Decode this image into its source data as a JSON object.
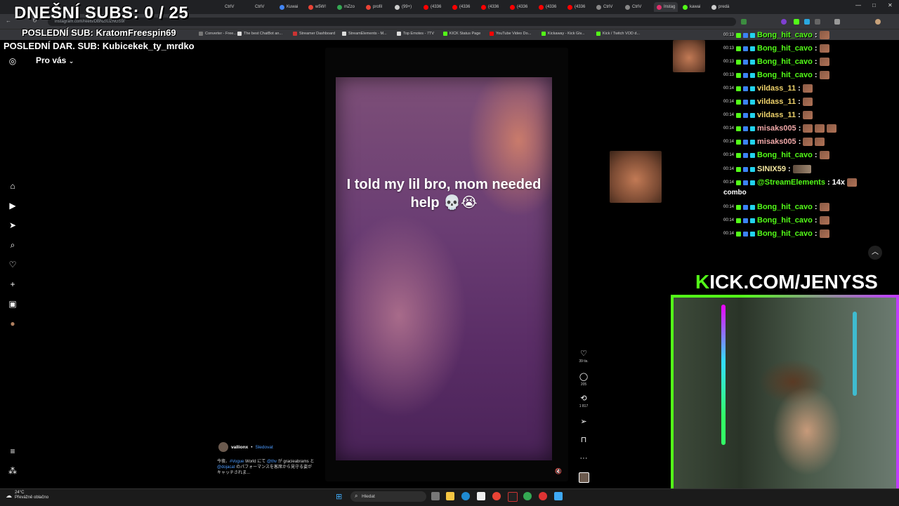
{
  "browser": {
    "tabs": [
      {
        "label": "Kuwai",
        "color": "#4285f4"
      },
      {
        "label": "w5W!",
        "color": "#ea4335"
      },
      {
        "label": "mZzo",
        "color": "#34a853"
      },
      {
        "label": "profil",
        "color": "#ea4335"
      },
      {
        "label": "(99+)",
        "color": "#cccccc"
      },
      {
        "label": "(4336",
        "color": "#ff0000"
      },
      {
        "label": "(4336",
        "color": "#ff0000"
      },
      {
        "label": "(4336",
        "color": "#ff0000"
      },
      {
        "label": "(4336",
        "color": "#ff0000"
      },
      {
        "label": "(4336",
        "color": "#ff0000"
      },
      {
        "label": "(4336",
        "color": "#ff0000"
      },
      {
        "label": "CtrlV",
        "color": "#888888"
      },
      {
        "label": "CtrlV",
        "color": "#888888"
      },
      {
        "label": "Instag",
        "color": "#e1306c"
      },
      {
        "label": "kawai",
        "color": "#53fc18"
      },
      {
        "label": "predá",
        "color": "#cccccc"
      }
    ],
    "left_tabs": [
      "CtrlV",
      "CtrlV"
    ],
    "url": "instagram.com/reels/DBNZIUZNGS9/",
    "bookmarks": [
      {
        "label": "Converter - Free...",
        "color": "#777777"
      },
      {
        "label": "The best ChatBot an...",
        "color": "#dddddd"
      },
      {
        "label": "Streamer Dashboard",
        "color": "#cc3333"
      },
      {
        "label": "StreamElements - M...",
        "color": "#dddddd"
      },
      {
        "label": "Top Emotes - 7TV",
        "color": "#dddddd"
      },
      {
        "label": "KICK Status Page",
        "color": "#53fc18"
      },
      {
        "label": "YouTube Video Do...",
        "color": "#ff0000"
      },
      {
        "label": "Kickaway - Kick Giv...",
        "color": "#53fc18"
      },
      {
        "label": "Kick / Twitch VOD d...",
        "color": "#53fc18"
      }
    ]
  },
  "overlay": {
    "subs_goal": "DNEŠNÍ SUBS: 0 / 25",
    "last_sub": "POSLEDNÍ SUB: KratomFreespin69",
    "last_gift": "POSLEDNÍ DAR. SUB: Kubicekek_ty_mrdko",
    "brand_k": "K",
    "brand_rest": "ICK.COM/JENYSS"
  },
  "instagram": {
    "feed_label": "Pro vás",
    "feed_chevron": "⌄",
    "caption": "I told my lil bro, mom needed help 💀😭",
    "actions": {
      "likes": "39 tis.",
      "comments": "205",
      "reposts": "1 817"
    },
    "author": "vallionx",
    "follow": "Sledovat",
    "description_parts": [
      "今夜、",
      "#Vogue",
      " World にて ",
      "@thv",
      " が gracieabrams と ",
      "@dojacat",
      " のパフォーマンスを客席から見守る姿が キャッチされま..."
    ]
  },
  "chat": {
    "messages": [
      {
        "time": "00:13",
        "user": "Bong_hit_cavo",
        "color": "#53fc18",
        "emotes": 1
      },
      {
        "time": "00:13",
        "user": "Bong_hit_cavo",
        "color": "#53fc18",
        "emotes": 1
      },
      {
        "time": "00:13",
        "user": "Bong_hit_cavo",
        "color": "#53fc18",
        "emotes": 1
      },
      {
        "time": "00:13",
        "user": "Bong_hit_cavo",
        "color": "#53fc18",
        "emotes": 1
      },
      {
        "time": "00:14",
        "user": "vildass_11",
        "color": "#f0d36b",
        "emotes": 1
      },
      {
        "time": "00:14",
        "user": "vildass_11",
        "color": "#f0d36b",
        "emotes": 1
      },
      {
        "time": "00:14",
        "user": "vildass_11",
        "color": "#f0d36b",
        "emotes": 1
      },
      {
        "time": "00:14",
        "user": "misaks005",
        "color": "#f0a8a8",
        "emotes": 3
      },
      {
        "time": "00:14",
        "user": "misaks005",
        "color": "#f0a8a8",
        "emotes": 2
      },
      {
        "time": "00:14",
        "user": "Bong_hit_cavo",
        "color": "#53fc18",
        "emotes": 1
      },
      {
        "time": "00:14",
        "user": "SINIX59",
        "color": "#f5e7a0",
        "emotes": 1
      },
      {
        "time": "00:14",
        "user": "@StreamElements",
        "color": "#53fc18",
        "text": "14x",
        "emotes": 1
      },
      {
        "time": "00:14",
        "user": "Bong_hit_cavo",
        "color": "#53fc18",
        "emotes": 1
      },
      {
        "time": "00:14",
        "user": "Bong_hit_cavo",
        "color": "#53fc18",
        "emotes": 1
      },
      {
        "time": "00:14",
        "user": "Bong_hit_cavo",
        "color": "#53fc18",
        "emotes": 1
      }
    ],
    "combo": "combo"
  },
  "taskbar": {
    "temp": "24°C",
    "weather": "Převážně oblačno",
    "search": "Hledat"
  },
  "colors": {
    "kick_green": "#53fc18",
    "ig_link": "#4c9bff"
  }
}
